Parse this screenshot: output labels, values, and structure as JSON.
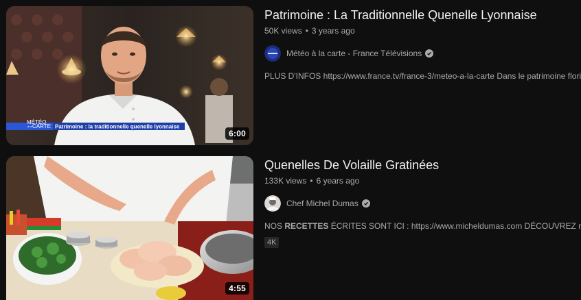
{
  "results": [
    {
      "title": "Patrimoine : La Traditionnelle Quenelle Lyonnaise",
      "views": "50K views",
      "age": "3 years ago",
      "channel": "Météo à la carte - France Télévisions",
      "description": "PLUS D'INFOS https://www.france.tv/france-3/meteo-a-la-carte Dans le patrimoine florissant",
      "duration": "6:00",
      "thumbnail_logo_line1": "MÉTÉO",
      "thumbnail_logo_line2": "CARTE",
      "thumbnail_logo_small": "à la",
      "thumbnail_banner": "Patrimoine : la traditionnelle quenelle lyonnaise"
    },
    {
      "title": "Quenelles De Volaille Gratinées",
      "views": "133K views",
      "age": "6 years ago",
      "channel": "Chef Michel Dumas",
      "description_prefix": "NOS ",
      "description_bold": "RECETTES",
      "description_suffix": " ÉCRITES SONT ICI : https://www.micheldumas.com DÉCOUVREZ nos cours",
      "badge": "4K",
      "duration": "4:55"
    }
  ],
  "meta_separator": "•",
  "icons": {
    "verified": "verified-check-icon",
    "avatar_1": "france-tv-avatar",
    "avatar_2": "chef-portrait-avatar"
  },
  "colors": {
    "background": "#0f0f0f",
    "title": "#f1f1f1",
    "secondary": "#aaaaaa",
    "banner_blue": "#1f3fa8"
  }
}
